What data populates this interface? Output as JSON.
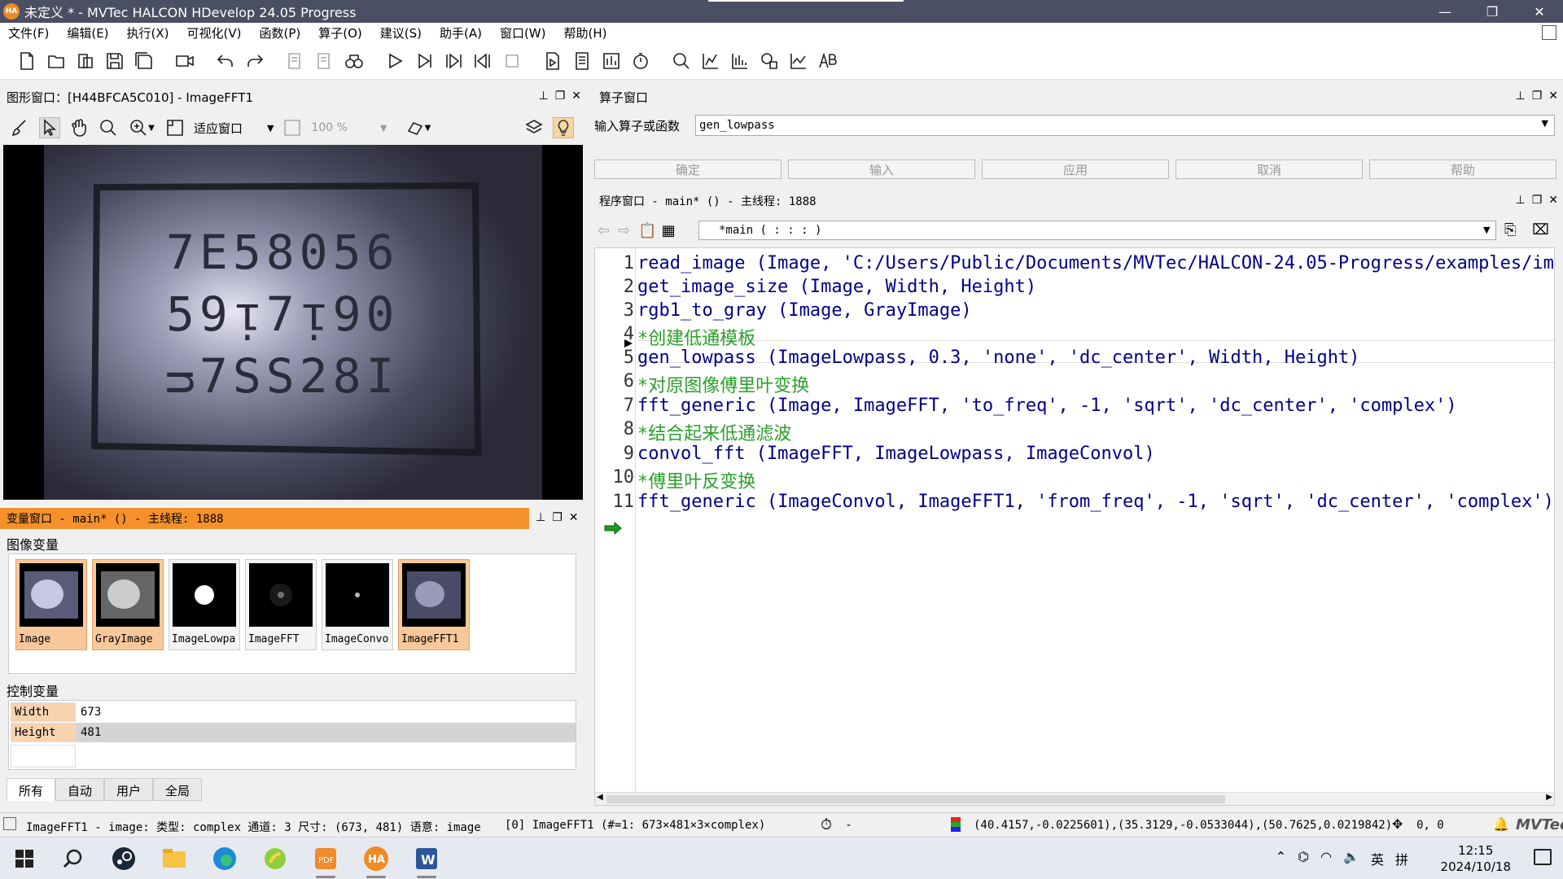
{
  "window": {
    "title": "未定义 * - MVTec HALCON HDevelop 24.05 Progress",
    "app_icon": "HA"
  },
  "menu": [
    "文件(F)",
    "编辑(E)",
    "执行(X)",
    "可视化(V)",
    "函数(P)",
    "算子(O)",
    "建议(S)",
    "助手(A)",
    "窗口(W)",
    "帮助(H)"
  ],
  "graphics_window": {
    "title": "图形窗口：[H44BFCA5C010] - ImageFFT1",
    "fit_label": "适应窗口",
    "zoom_label": "100 %",
    "image_text": [
      "7E58056",
      "59ᴉ7ᴉ90",
      "ᴝ7SS28I"
    ]
  },
  "variables_window": {
    "title": "变量窗口 - main* () - 主线程: 1888",
    "image_vars_label": "图像变量",
    "image_vars": [
      "Image",
      "GrayImage",
      "ImageLowpa",
      "ImageFFT",
      "ImageConvo",
      "ImageFFT1"
    ],
    "control_vars_label": "控制变量",
    "control_vars": [
      {
        "name": "Width",
        "value": "673"
      },
      {
        "name": "Height",
        "value": "481"
      }
    ],
    "tabs": [
      "所有",
      "自动",
      "用户",
      "全局"
    ]
  },
  "operator_window": {
    "title": "算子窗口",
    "input_label": "输入算子或函数",
    "input_value": "gen_lowpass",
    "buttons": [
      "确定",
      "输入",
      "应用",
      "取消",
      "帮助"
    ]
  },
  "program_window": {
    "title": "程序窗口 - main* () - 主线程: 1888",
    "procedure": "*main ( : : : )",
    "lines": [
      {
        "n": "1",
        "text": "read_image (Image, 'C:/Users/Public/Documents/MVTec/HALCON-24.05-Progress/examples/imag",
        "comment": false
      },
      {
        "n": "2",
        "text": "get_image_size (Image, Width, Height)",
        "comment": false
      },
      {
        "n": "3",
        "text": "rgb1_to_gray (Image, GrayImage)",
        "comment": false
      },
      {
        "n": "4",
        "text": "*创建低通模板",
        "comment": true
      },
      {
        "n": "5",
        "text": "gen_lowpass (ImageLowpass, 0.3, 'none', 'dc_center', Width, Height)",
        "comment": false
      },
      {
        "n": "6",
        "text": "*对原图像傅里叶变换",
        "comment": true
      },
      {
        "n": "7",
        "text": "fft_generic (Image, ImageFFT, 'to_freq', -1, 'sqrt', 'dc_center', 'complex')",
        "comment": false
      },
      {
        "n": "8",
        "text": "*结合起来低通滤波",
        "comment": true
      },
      {
        "n": "9",
        "text": "convol_fft (ImageFFT, ImageLowpass, ImageConvol)",
        "comment": false
      },
      {
        "n": "10",
        "text": "*傅里叶反变换",
        "comment": true
      },
      {
        "n": "11",
        "text": "fft_generic (ImageConvol, ImageFFT1, 'from_freq', -1, 'sqrt', 'dc_center', 'complex')",
        "comment": false
      }
    ]
  },
  "statusbar": {
    "image_info": "ImageFFT1 - image: 类型: complex 通道: 3 尺寸: (673, 481) 语意: image",
    "object_info": "[0] ImageFFT1 (#=1: 673×481×3×complex)",
    "timer": "-",
    "pixel_values": "(40.4157,-0.0225601),(35.3129,-0.0533044),(50.7625,0.0219842)",
    "coords": "0, 0",
    "brand": "MVTec"
  },
  "taskbar": {
    "time": "12:15",
    "date": "2024/10/18",
    "ime": "英",
    "ime2": "拼"
  },
  "colors": {
    "title_bg": "#4b4f64",
    "var_head": "#f5902a",
    "code": "#00008b",
    "comment": "#2aa02a"
  }
}
